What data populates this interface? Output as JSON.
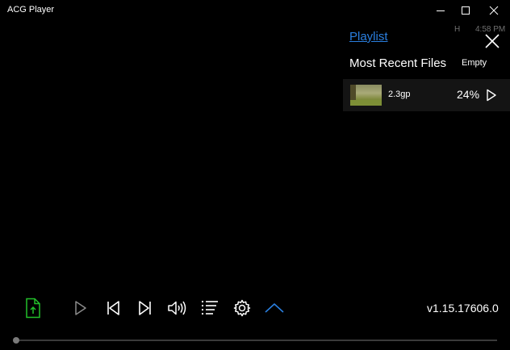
{
  "window": {
    "title": "ACG Player"
  },
  "status": {
    "indicator": "H",
    "time": "4:58 PM"
  },
  "playlist": {
    "link_label": "Playlist",
    "section_title": "Most Recent Files",
    "empty_label": "Empty",
    "files": [
      {
        "name": "2.3gp",
        "progress": "24%"
      }
    ]
  },
  "controls": {
    "icons": [
      "open-file-icon",
      "play-icon",
      "previous-icon",
      "next-icon",
      "volume-icon",
      "playlist-icon",
      "settings-icon",
      "chevron-up-icon"
    ],
    "accent_green": "#22c02a",
    "accent_blue": "#2a7fe0"
  },
  "footer": {
    "version": "v1.15.17606.0"
  },
  "seek": {
    "position_fraction": 0.0
  }
}
